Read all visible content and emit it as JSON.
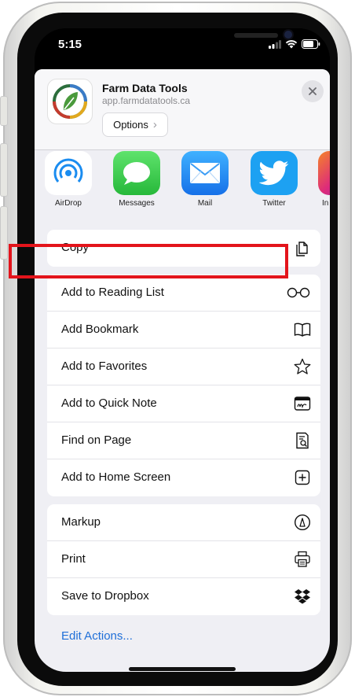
{
  "status_bar": {
    "time": "5:15"
  },
  "header": {
    "app_title": "Farm Data Tools",
    "app_url": "app.farmdatatools.ca",
    "options_label": "Options",
    "options_chevron": "›"
  },
  "share_targets": [
    {
      "label": "AirDrop",
      "icon": "airdrop-icon",
      "color": "#ffffff"
    },
    {
      "label": "Messages",
      "icon": "messages-icon",
      "color": "#34c759"
    },
    {
      "label": "Mail",
      "icon": "mail-icon",
      "color": "#1e90ff"
    },
    {
      "label": "Twitter",
      "icon": "twitter-icon",
      "color": "#1da1f2"
    },
    {
      "label": "In",
      "icon": "instagram-icon",
      "color": "#e1306c"
    }
  ],
  "groups": {
    "copy": {
      "items": [
        "Copy"
      ]
    },
    "actions": {
      "items": [
        "Add to Reading List",
        "Add Bookmark",
        "Add to Favorites",
        "Add to Quick Note",
        "Find on Page",
        "Add to Home Screen"
      ]
    },
    "more": {
      "items": [
        "Markup",
        "Print",
        "Save to Dropbox"
      ]
    }
  },
  "highlighted_item": "Add Bookmark",
  "highlight_color": "#e3141b",
  "edit_actions_label": "Edit Actions..."
}
